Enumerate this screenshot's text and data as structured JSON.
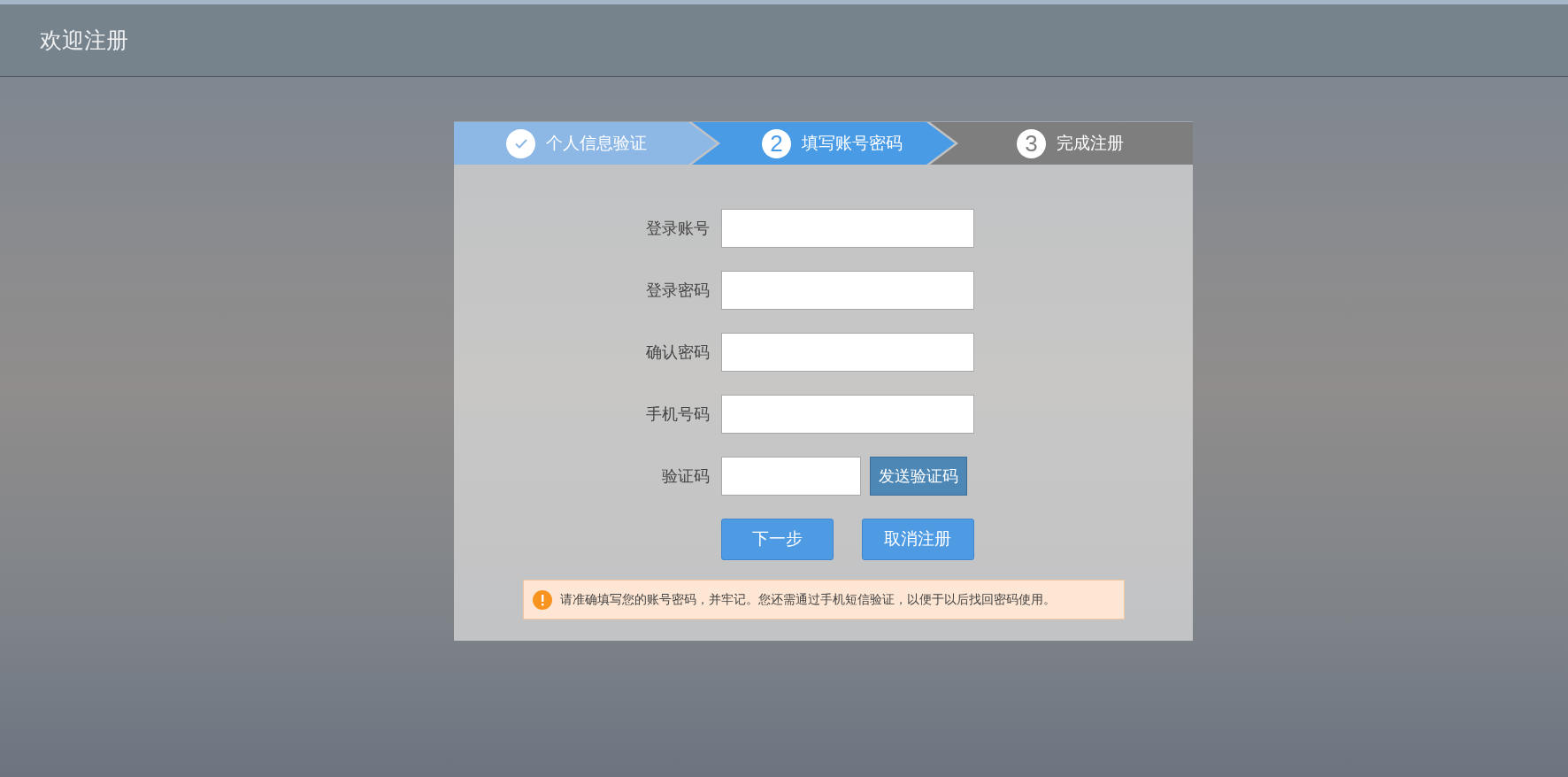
{
  "header": {
    "title": "欢迎注册"
  },
  "steps": [
    {
      "label": "个人信息验证",
      "kind": "done"
    },
    {
      "number": "2",
      "label": "填写账号密码",
      "kind": "current"
    },
    {
      "number": "3",
      "label": "完成注册",
      "kind": "pending"
    }
  ],
  "form": {
    "fields": [
      {
        "kind": "text",
        "label": "登录账号"
      },
      {
        "kind": "text",
        "label": "登录密码"
      },
      {
        "kind": "text",
        "label": "确认密码"
      },
      {
        "kind": "text",
        "label": "手机号码"
      },
      {
        "kind": "code",
        "label": "验证码",
        "button": "发送验证码"
      }
    ],
    "buttons": [
      "下一步",
      "取消注册"
    ]
  },
  "notice": {
    "text": "请准确填写您的账号密码，并牢记。您还需通过手机短信验证，以便于以后找回密码使用。"
  }
}
